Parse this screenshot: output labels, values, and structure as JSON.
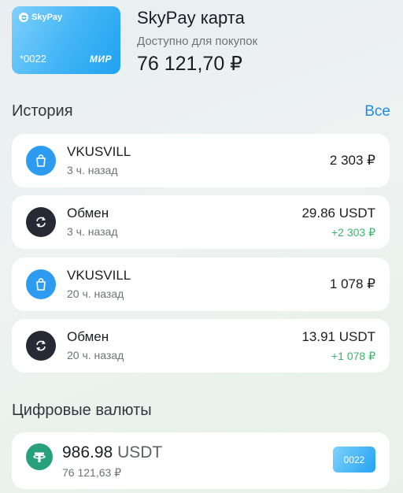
{
  "card": {
    "brand": "SkyPay",
    "number": "*0022",
    "network": "МИР"
  },
  "account": {
    "title": "SkyPay карта",
    "available_label": "Доступно для покупок",
    "balance": "76 121,70 ₽"
  },
  "history": {
    "title": "История",
    "all_link": "Все",
    "items": [
      {
        "icon": "shopping-bag-icon",
        "name": "VKUSVILL",
        "time": "3 ч. назад",
        "amount": "2 303 ₽",
        "sub_amount": ""
      },
      {
        "icon": "exchange-icon",
        "name": "Обмен",
        "time": "3 ч. назад",
        "amount": "29.86 USDT",
        "sub_amount": "+2 303 ₽"
      },
      {
        "icon": "shopping-bag-icon",
        "name": "VKUSVILL",
        "time": "20 ч. назад",
        "amount": "1 078 ₽",
        "sub_amount": ""
      },
      {
        "icon": "exchange-icon",
        "name": "Обмен",
        "time": "20 ч. назад",
        "amount": "13.91 USDT",
        "sub_amount": "+1 078 ₽"
      }
    ]
  },
  "crypto": {
    "title": "Цифровые валюты",
    "items": [
      {
        "icon": "tether-icon",
        "amount": "986.98",
        "currency": "USDT",
        "fiat": "76 121,63 ₽",
        "card": "0022"
      }
    ]
  },
  "colors": {
    "accent": "#1c8cef",
    "positive": "#3bb46b",
    "card": "#45b6f6",
    "dark_icon": "#272a34",
    "tether": "#26a17b"
  }
}
